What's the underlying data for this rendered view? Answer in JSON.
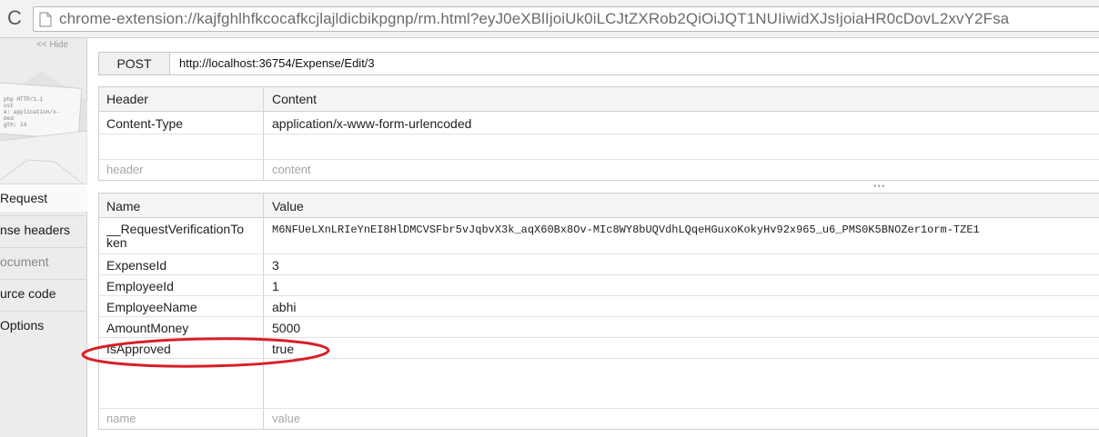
{
  "browser": {
    "reload_icon": "reload-icon",
    "page_icon": "page-icon",
    "url": "chrome-extension://kajfghlhfkcocafkcjlajldicbikpgnp/rm.html?eyJ0eXBlIjoiUk0iLCJtZXRob2QiOiJQT1NUIiwidXJsIjoiaHR0cDovL2xvY2Fsa"
  },
  "sidebar": {
    "hide_label": "<< Hide",
    "logo_icon": "envelope-http-logo",
    "logo_lines": [
      "php HTTP/1.1",
      "ost",
      "e: application/x-",
      "ded",
      "gth: 14"
    ],
    "items": [
      {
        "label": "Request",
        "state": "selected"
      },
      {
        "label": "nse headers",
        "state": "normal"
      },
      {
        "label": "ocument",
        "state": "muted"
      },
      {
        "label": "urce code",
        "state": "normal"
      },
      {
        "label": "Options",
        "state": "normal"
      }
    ]
  },
  "request": {
    "method": "POST",
    "url": "http://localhost:36754/Expense/Edit/3"
  },
  "headers_table": {
    "col_header": "Header",
    "col_content": "Content",
    "rows": [
      {
        "header": "Content-Type",
        "content": "application/x-www-form-urlencoded"
      }
    ],
    "placeholder_header": "header",
    "placeholder_content": "content"
  },
  "resize_grip": "•••",
  "params_table": {
    "col_name": "Name",
    "col_value": "Value",
    "token_name_line1": "__RequestVerificationTo",
    "token_name_line2": "ken",
    "token_value": "M6NFUeLXnLRIeYnEI8HlDMCVSFbr5vJqbvX3k_aqX60Bx8Ov-MIc8WY8bUQVdhLQqeHGuxoKokyHv92x965_u6_PMS0K5BNOZer1orm-TZE1",
    "rows": [
      {
        "name": "ExpenseId",
        "value": "3"
      },
      {
        "name": "EmployeeId",
        "value": "1"
      },
      {
        "name": "EmployeeName",
        "value": "abhi"
      },
      {
        "name": "AmountMoney",
        "value": "5000"
      },
      {
        "name": "IsApproved",
        "value": "true"
      }
    ],
    "placeholder_name": "name",
    "placeholder_value": "value"
  },
  "annotation": {
    "color": "#d81f26",
    "target": "IsApproved"
  }
}
